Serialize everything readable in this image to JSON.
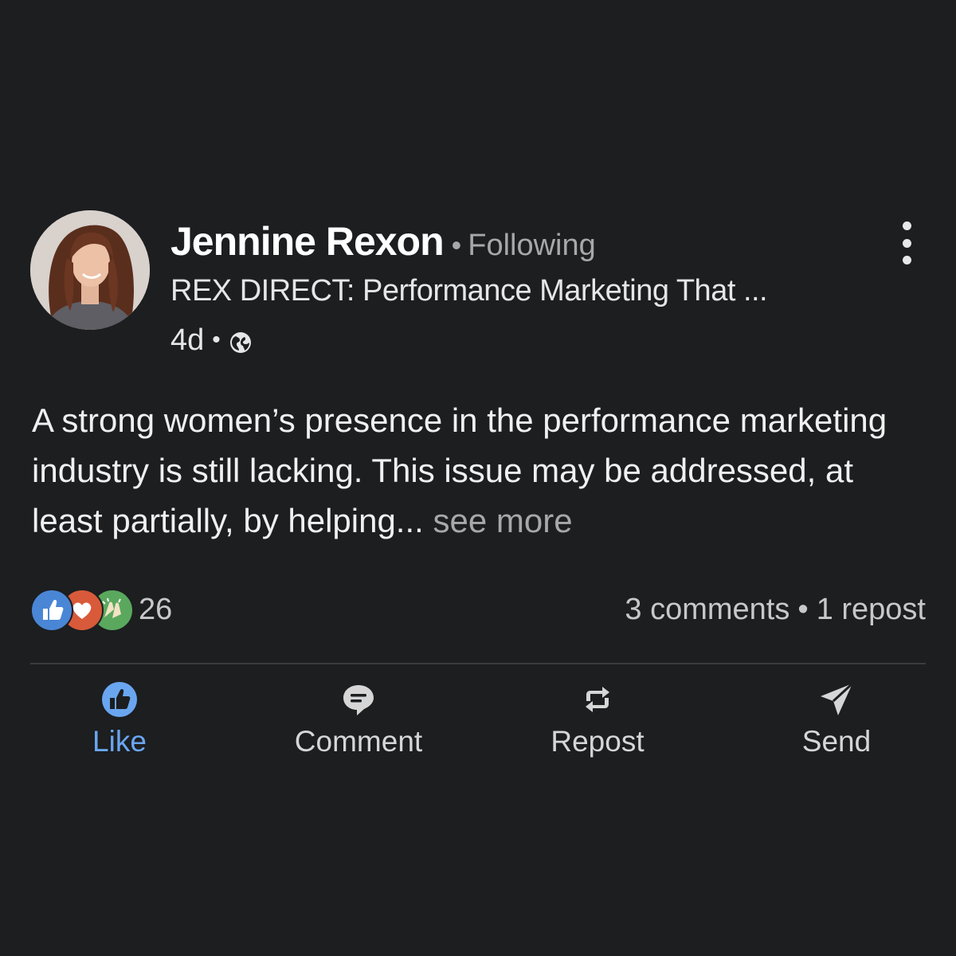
{
  "post": {
    "author": {
      "name": "Jennine Rexon",
      "follow_status": "Following",
      "headline": "REX DIRECT: Performance Marketing That ...",
      "age": "4d",
      "visibility_icon": "globe-icon"
    },
    "menu_icon": "more-vertical-icon",
    "body": {
      "text": "A strong women’s presence in the performance marketing industry is still lacking. This issue may be addressed, at least partially, by helping...",
      "see_more": "see more"
    },
    "social": {
      "reaction_icons": [
        "like-reaction-icon",
        "love-reaction-icon",
        "celebrate-reaction-icon"
      ],
      "reaction_count": "26",
      "comments": "3 comments",
      "reposts": "1 repost"
    },
    "actions": [
      {
        "label": "Like",
        "icon": "thumbs-up-icon",
        "active": true
      },
      {
        "label": "Comment",
        "icon": "comment-icon",
        "active": false
      },
      {
        "label": "Repost",
        "icon": "repost-icon",
        "active": false
      },
      {
        "label": "Send",
        "icon": "send-icon",
        "active": false
      }
    ]
  },
  "colors": {
    "background": "#1c1e20",
    "like_active": "#6aa6f0",
    "like_reaction": "#4a86d6",
    "love_reaction": "#d85a3a",
    "celebrate_reaction": "#5aa85e"
  }
}
